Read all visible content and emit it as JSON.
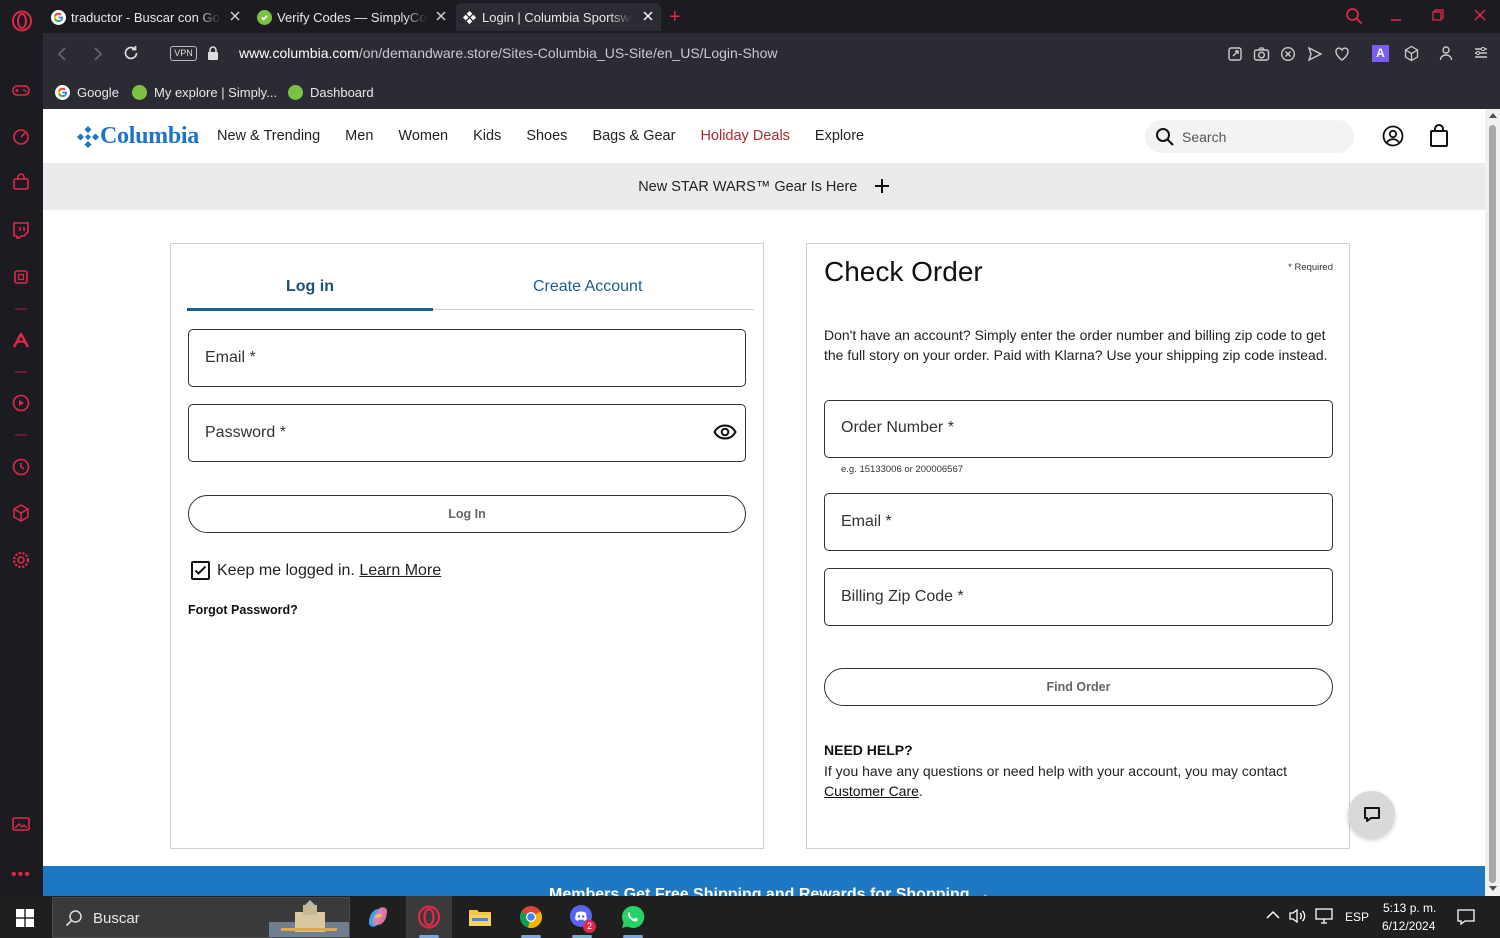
{
  "browser": {
    "tabs": [
      {
        "title": "traductor - Buscar con Google",
        "active": false
      },
      {
        "title": "Verify Codes — SimplyCodes",
        "active": false
      },
      {
        "title": "Login | Columbia Sportswear",
        "active": true
      }
    ],
    "vpn_label": "VPN",
    "url_host": "www.columbia.com",
    "url_path": "/on/demandware.store/Sites-Columbia_US-Site/en_US/Login-Show",
    "bookmarks": [
      {
        "label": "Google"
      },
      {
        "label": "My explore | Simply..."
      },
      {
        "label": "Dashboard"
      }
    ],
    "ext_badge": "A"
  },
  "site": {
    "logo": "Columbia",
    "menu": [
      "New & Trending",
      "Men",
      "Women",
      "Kids",
      "Shoes",
      "Bags & Gear",
      "Holiday Deals",
      "Explore"
    ],
    "search_placeholder": "Search",
    "promo": "New STAR WARS™ Gear Is Here",
    "login": {
      "tab_login": "Log in",
      "tab_create": "Create Account",
      "email_label": "Email *",
      "password_label": "Password *",
      "login_button": "Log In",
      "keep_logged": "Keep me logged in.",
      "learn_more": "Learn More",
      "forgot": "Forgot Password?"
    },
    "check_order": {
      "title": "Check Order",
      "required": "* Required",
      "description": "Don't have an account? Simply enter the order number and billing zip code to get the full story on your order. Paid with Klarna? Use your shipping zip code instead.",
      "order_number_label": "Order Number *",
      "order_hint": "e.g. 15133006 or 200006567",
      "email_label": "Email *",
      "zip_label": "Billing Zip Code *",
      "find_button": "Find Order",
      "help_title": "NEED HELP?",
      "help_text": "If you have any questions or need help with your account, you may contact",
      "customer_care": "Customer Care",
      "period": "."
    },
    "footer_band": "Members Get Free Shipping and Rewards for Shopping →"
  },
  "taskbar": {
    "search_label": "Buscar",
    "language": "ESP",
    "time": "5:13 p. m.",
    "date": "6/12/2024",
    "discord_badge": "2"
  },
  "colors": {
    "opera_red": "#e0294a",
    "columbia_blue": "#1f74c8",
    "deals_red": "#b3272d",
    "link_blue": "#1f5c8a"
  }
}
